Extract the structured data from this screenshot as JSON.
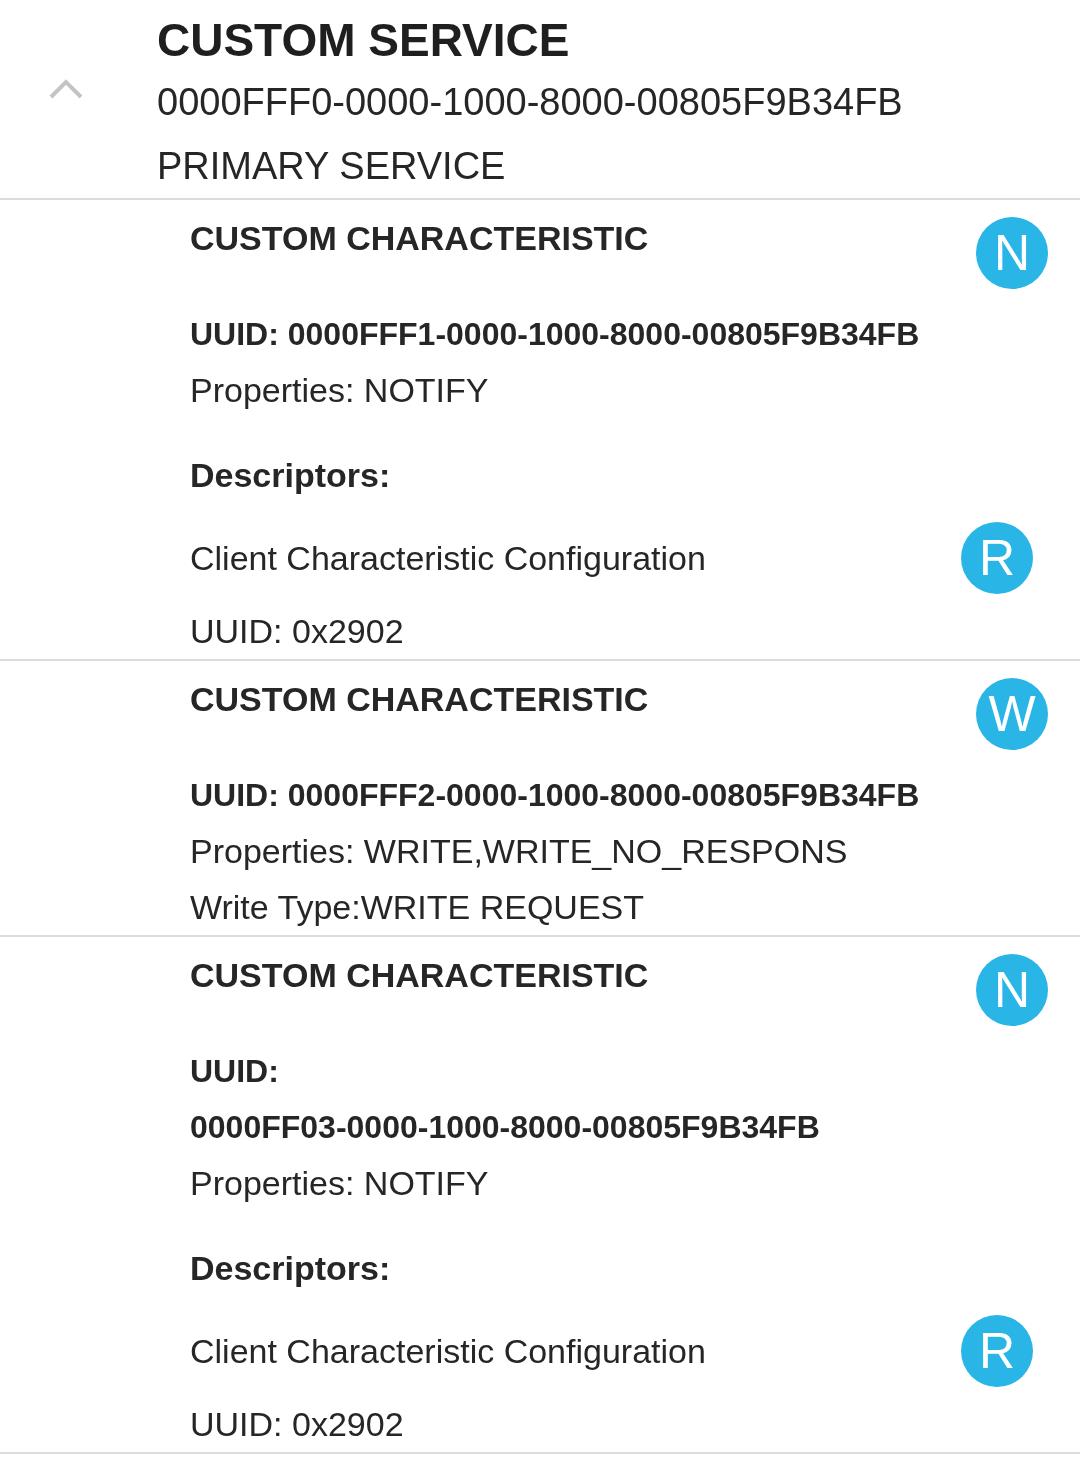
{
  "service": {
    "title": "CUSTOM SERVICE",
    "expanded": true,
    "uuid": "0000FFF0-0000-1000-8000-00805F9B34FB",
    "type": "PRIMARY SERVICE"
  },
  "characteristics": [
    {
      "title": "CUSTOM CHARACTERISTIC",
      "badge": "N",
      "uuid_label": "UUID:",
      "uuid": "0000FFF1-0000-1000-8000-00805F9B34FB",
      "kind": "inline",
      "lines": [
        "Properties: NOTIFY"
      ],
      "descriptors_heading": "Descriptors:",
      "descriptors": [
        {
          "name": "Client Characteristic Configuration",
          "badge": "R",
          "uuid": "UUID: 0x2902"
        }
      ]
    },
    {
      "title": "CUSTOM CHARACTERISTIC",
      "badge": "W",
      "uuid_label": "UUID:",
      "uuid": "0000FFF2-0000-1000-8000-00805F9B34FB",
      "kind": "inline",
      "lines": [
        "Properties: WRITE,WRITE_NO_RESPONS",
        "Write Type:WRITE REQUEST"
      ]
    },
    {
      "title": "CUSTOM CHARACTERISTIC",
      "badge": "N",
      "uuid_label": "UUID:",
      "uuid": "0000FF03-0000-1000-8000-00805F9B34FB",
      "kind": "stacked",
      "lines": [
        "Properties: NOTIFY"
      ],
      "descriptors_heading": "Descriptors:",
      "descriptors": [
        {
          "name": "Client Characteristic Configuration",
          "badge": "R",
          "uuid": "UUID: 0x2902"
        }
      ]
    }
  ]
}
